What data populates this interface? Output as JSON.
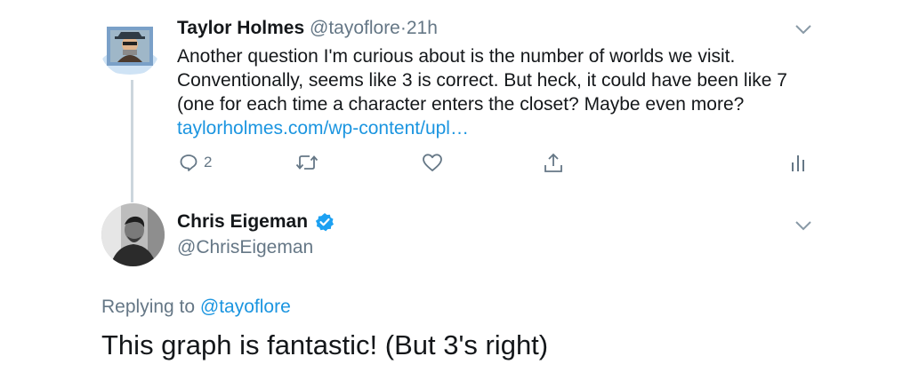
{
  "tweet": {
    "author_name": "Taylor Holmes",
    "author_handle": "@tayoflore",
    "separator": "·",
    "time": "21h",
    "text": "Another question I'm curious about is the number of worlds we visit. Conventionally, seems like 3 is correct. But heck, it could have been like 7 (one for each time a character enters the closet? Maybe even more? ",
    "link": "taylorholmes.com/wp-content/upl…",
    "reply_count": "2",
    "icons": [
      "reply-icon",
      "retweet-icon",
      "like-icon",
      "share-icon",
      "analytics-icon",
      "chevron-down-icon"
    ]
  },
  "reply": {
    "author_name": "Chris Eigeman",
    "author_handle": "@ChrisEigeman",
    "verified": true,
    "replying_prefix": "Replying to",
    "replying_to": "@tayoflore",
    "text": "This graph is fantastic! (But 3's right)"
  },
  "colors": {
    "link": "#1b95e0",
    "secondary_text": "#657786",
    "primary_text": "#14171a",
    "thread_line": "#ccd6dd",
    "verified": "#1da1f2"
  }
}
